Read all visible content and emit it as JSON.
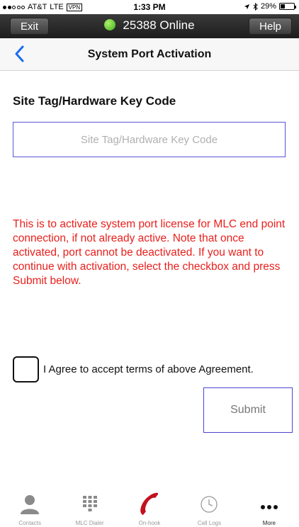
{
  "status_bar": {
    "carrier": "AT&T",
    "network": "LTE",
    "vpn": "VPN",
    "time": "1:33 PM",
    "battery": "29%",
    "battery_level": 0.29
  },
  "header": {
    "exit_label": "Exit",
    "online_text": "25388 Online",
    "help_label": "Help"
  },
  "nav": {
    "title": "System Port Activation"
  },
  "form": {
    "key_label": "Site Tag/Hardware Key Code",
    "key_placeholder": "Site Tag/Hardware Key Code",
    "key_value": "",
    "warning": "This is to activate system port license for MLC end point connection, if not already active. Note that once activated, port cannot be deactivated. If you want to continue with activation, select the checkbox and press Submit below.",
    "agree_label": "I Agree to accept terms of above Agreement.",
    "agree_checked": false,
    "submit_label": "Submit"
  },
  "tabs": [
    {
      "label": "Contacts",
      "icon": "contacts-icon"
    },
    {
      "label": "MLC Dialer",
      "icon": "keypad-icon"
    },
    {
      "label": "On-hook",
      "icon": "phone-handset-icon"
    },
    {
      "label": "Call Logs",
      "icon": "clock-icon"
    },
    {
      "label": "More",
      "icon": "more-dots-icon",
      "active": true
    }
  ],
  "colors": {
    "accent_red": "#e8201d",
    "accent_blue": "#5a55d8",
    "online_green": "#3fae1a",
    "onhook_red": "#c0121e"
  }
}
